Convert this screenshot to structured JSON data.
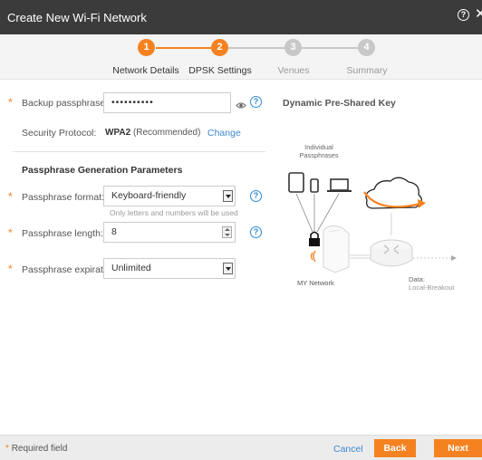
{
  "window": {
    "title": "Create New Wi-Fi Network",
    "help_glyph": "?",
    "close_glyph": "✕"
  },
  "wizard": {
    "steps": [
      {
        "number": "1",
        "label": "Network Details",
        "state": "completed"
      },
      {
        "number": "2",
        "label": "DPSK Settings",
        "state": "current"
      },
      {
        "number": "3",
        "label": "Venues",
        "state": "pending"
      },
      {
        "number": "4",
        "label": "Summary",
        "state": "pending"
      }
    ],
    "colors": {
      "active": "#f58220",
      "inactive": "#c8c8c8",
      "active_label": "#333333",
      "inactive_label": "#9a9a9a"
    }
  },
  "form": {
    "required_marker": "*",
    "backup_passphrase": {
      "label": "Backup passphrase:",
      "value": "••••••••••"
    },
    "security_protocol": {
      "label": "Security Protocol:",
      "value": "WPA2",
      "note": "(Recommended)",
      "action": "Change"
    },
    "section_title": "Passphrase Generation Parameters",
    "passphrase_format": {
      "label": "Passphrase format:",
      "value": "Keyboard-friendly",
      "hint": "Only letters and numbers will be used"
    },
    "passphrase_length": {
      "label": "Passphrase length:",
      "value": "8"
    },
    "passphrase_expiration": {
      "label": "Passphrase expiration:",
      "value": "Unlimited"
    },
    "help_glyph": "?",
    "eye_icon": "eye-icon"
  },
  "diagram": {
    "title": "Dynamic Pre-Shared Key",
    "individual_label_line1": "Individual",
    "individual_label_line2": "Passphrases",
    "network_label": "MY Network",
    "data_label_line1": "Data:",
    "data_label_line2": "Local-Breakout"
  },
  "footer": {
    "required_note": "Required field",
    "cancel": "Cancel",
    "back": "Back",
    "next": "Next"
  },
  "colors": {
    "accent": "#f58220",
    "link": "#3d88cf",
    "header": "#3b3b3b"
  }
}
